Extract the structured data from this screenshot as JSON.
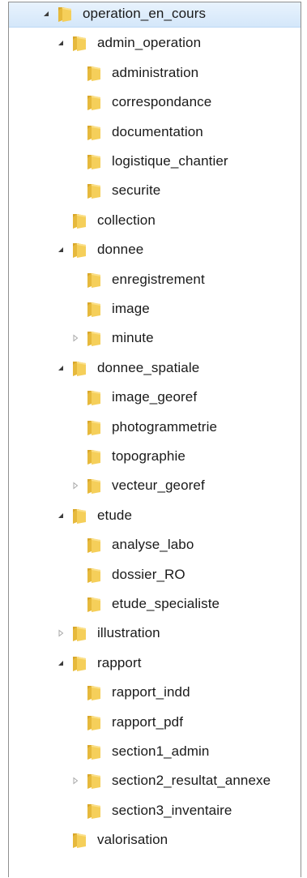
{
  "tree": [
    {
      "label": "operation_en_cours",
      "depth": 0,
      "expander": "expanded",
      "selected": true
    },
    {
      "label": "admin_operation",
      "depth": 1,
      "expander": "expanded"
    },
    {
      "label": "administration",
      "depth": 2,
      "expander": "none"
    },
    {
      "label": "correspondance",
      "depth": 2,
      "expander": "none"
    },
    {
      "label": "documentation",
      "depth": 2,
      "expander": "none"
    },
    {
      "label": "logistique_chantier",
      "depth": 2,
      "expander": "none"
    },
    {
      "label": "securite",
      "depth": 2,
      "expander": "none"
    },
    {
      "label": "collection",
      "depth": 1,
      "expander": "none"
    },
    {
      "label": "donnee",
      "depth": 1,
      "expander": "expanded"
    },
    {
      "label": "enregistrement",
      "depth": 2,
      "expander": "none"
    },
    {
      "label": "image",
      "depth": 2,
      "expander": "none"
    },
    {
      "label": "minute",
      "depth": 2,
      "expander": "collapsed"
    },
    {
      "label": "donnee_spatiale",
      "depth": 1,
      "expander": "expanded"
    },
    {
      "label": "image_georef",
      "depth": 2,
      "expander": "none"
    },
    {
      "label": "photogrammetrie",
      "depth": 2,
      "expander": "none"
    },
    {
      "label": "topographie",
      "depth": 2,
      "expander": "none"
    },
    {
      "label": "vecteur_georef",
      "depth": 2,
      "expander": "collapsed"
    },
    {
      "label": "etude",
      "depth": 1,
      "expander": "expanded"
    },
    {
      "label": "analyse_labo",
      "depth": 2,
      "expander": "none"
    },
    {
      "label": "dossier_RO",
      "depth": 2,
      "expander": "none"
    },
    {
      "label": "etude_specialiste",
      "depth": 2,
      "expander": "none"
    },
    {
      "label": "illustration",
      "depth": 1,
      "expander": "collapsed"
    },
    {
      "label": "rapport",
      "depth": 1,
      "expander": "expanded"
    },
    {
      "label": "rapport_indd",
      "depth": 2,
      "expander": "none"
    },
    {
      "label": "rapport_pdf",
      "depth": 2,
      "expander": "none"
    },
    {
      "label": "section1_admin",
      "depth": 2,
      "expander": "none"
    },
    {
      "label": "section2_resultat_annexe",
      "depth": 2,
      "expander": "collapsed"
    },
    {
      "label": "section3_inventaire",
      "depth": 2,
      "expander": "none"
    },
    {
      "label": "valorisation",
      "depth": 1,
      "expander": "none"
    }
  ],
  "icons": {
    "folder": "folder-icon",
    "expanded": "triangle-expanded-icon",
    "collapsed": "triangle-collapsed-icon"
  },
  "colors": {
    "selection": "#d4e7fa",
    "folder_front": "#f2c94c",
    "folder_back": "#d9a72a",
    "arrow_dark": "#3c3c3c",
    "arrow_light": "#a8a8a8"
  }
}
